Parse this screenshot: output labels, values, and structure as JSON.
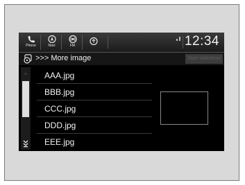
{
  "topbar": {
    "buttons": [
      {
        "label": "Phone",
        "icon": "phone-icon"
      },
      {
        "label": "Navi",
        "icon": "navi-icon"
      },
      {
        "label": "FM",
        "icon": "radio-icon"
      },
      {
        "label": "",
        "icon": "audio-source-icon"
      }
    ],
    "clock": "12:34"
  },
  "header": {
    "breadcrumb": ">>> More image",
    "start_button": "Start slideshow"
  },
  "files": [
    {
      "name": "AAA.jpg"
    },
    {
      "name": "BBB.jpg"
    },
    {
      "name": "CCC.jpg"
    },
    {
      "name": "DDD.jpg"
    },
    {
      "name": "EEE.jpg"
    }
  ],
  "colors": {
    "screen_bg": "#000000",
    "text": "#f2f2f2",
    "frame": "#d9d9d9"
  }
}
